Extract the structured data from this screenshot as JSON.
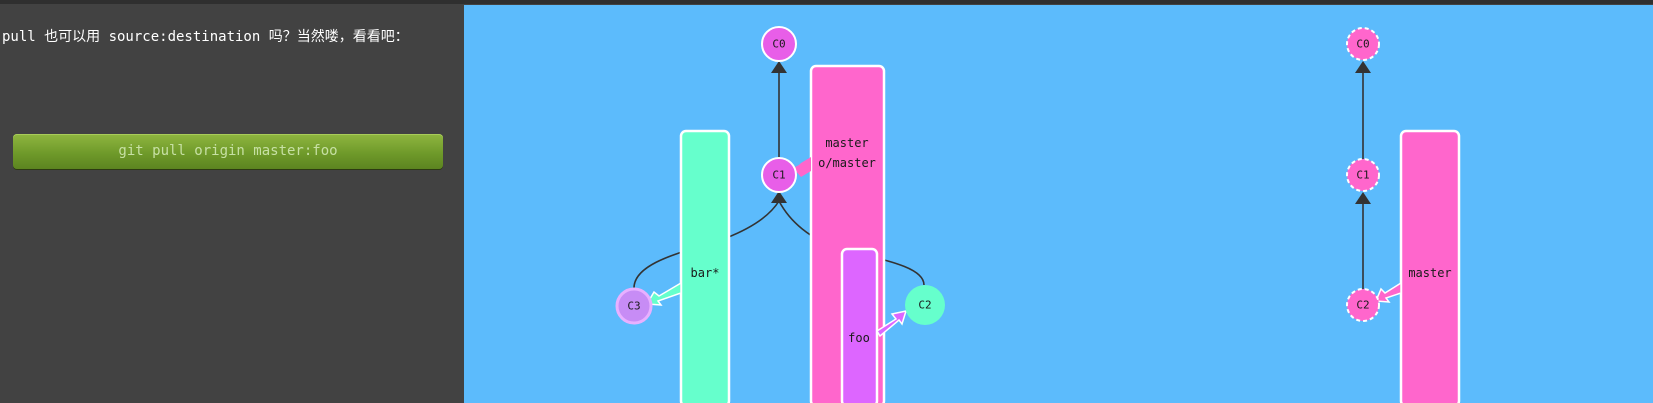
{
  "instructions": {
    "text": "pull 也可以用 source:destination 吗？当然喽，看看吧："
  },
  "command_button": {
    "label": "git pull origin master:foo"
  },
  "local_repo": {
    "commits": [
      "C0",
      "C1",
      "C2",
      "C3"
    ],
    "branches": [
      "master",
      "o/master",
      "foo",
      "bar*"
    ]
  },
  "remote_repo": {
    "commits": [
      "C0",
      "C1",
      "C2"
    ],
    "branches": [
      "master"
    ]
  },
  "colors": {
    "canvas": "#5cbbfc",
    "sidebar": "#424242",
    "master": "#ff66cc",
    "bar": "#66ffcc",
    "foo": "#dd66ff",
    "commit_default": "#e85ee8",
    "commit_bar": "#c78cf5",
    "commit_foo": "#66ffcc"
  }
}
